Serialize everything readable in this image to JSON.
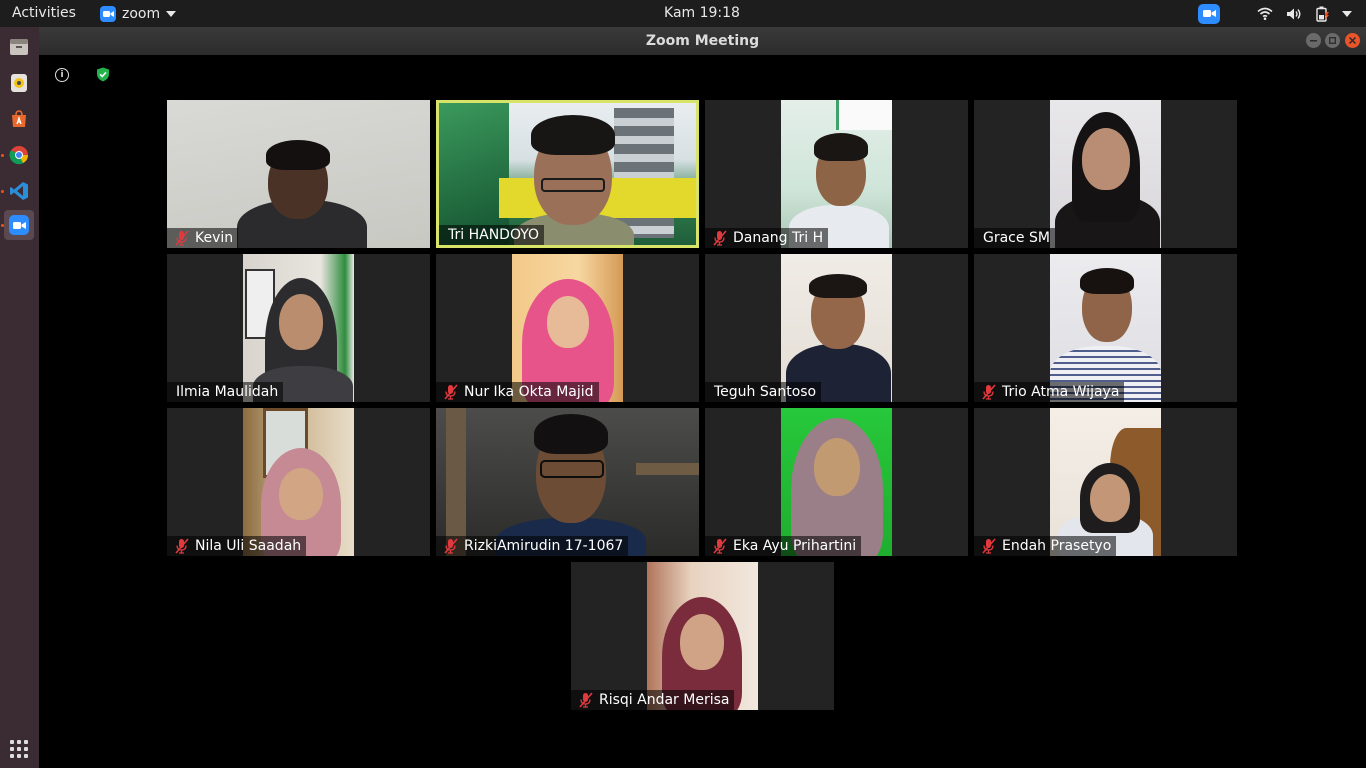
{
  "topbar": {
    "activities": "Activities",
    "app_name": "zoom",
    "clock": "Kam 19:18"
  },
  "window": {
    "title": "Zoom Meeting"
  },
  "participants": [
    {
      "name": "Kevin",
      "muted": true
    },
    {
      "name": "Tri HANDOYO",
      "muted": false,
      "active_speaker": true
    },
    {
      "name": "Danang Tri H",
      "muted": true
    },
    {
      "name": "Grace SM",
      "muted": false
    },
    {
      "name": "Ilmia Maulidah",
      "muted": false
    },
    {
      "name": "Nur Ika Okta Majid",
      "muted": true
    },
    {
      "name": "Teguh Santoso",
      "muted": false
    },
    {
      "name": "Trio Atma Wijaya",
      "muted": true
    },
    {
      "name": "Nila Uli Saadah",
      "muted": true
    },
    {
      "name": "RizkiAmirudin 17-1067",
      "muted": true
    },
    {
      "name": "Eka Ayu Prihartini",
      "muted": true
    },
    {
      "name": "Endah Prasetyo",
      "muted": true
    },
    {
      "name": "Risqi Andar Merisa",
      "muted": true
    }
  ],
  "colors": {
    "active_speaker_border": "#d8e36a",
    "mute_icon": "#e0393e",
    "zoom_blue": "#2d8cff",
    "dock_bg": "#3b2c33"
  },
  "icons": {
    "dock": [
      "files-icon",
      "rhythmbox-icon",
      "software-icon",
      "chrome-icon",
      "vscode-icon",
      "zoom-icon"
    ],
    "tray": [
      "zoom-tray-icon",
      "wifi-icon",
      "volume-icon",
      "battery-icon",
      "dropdown-icon"
    ]
  }
}
